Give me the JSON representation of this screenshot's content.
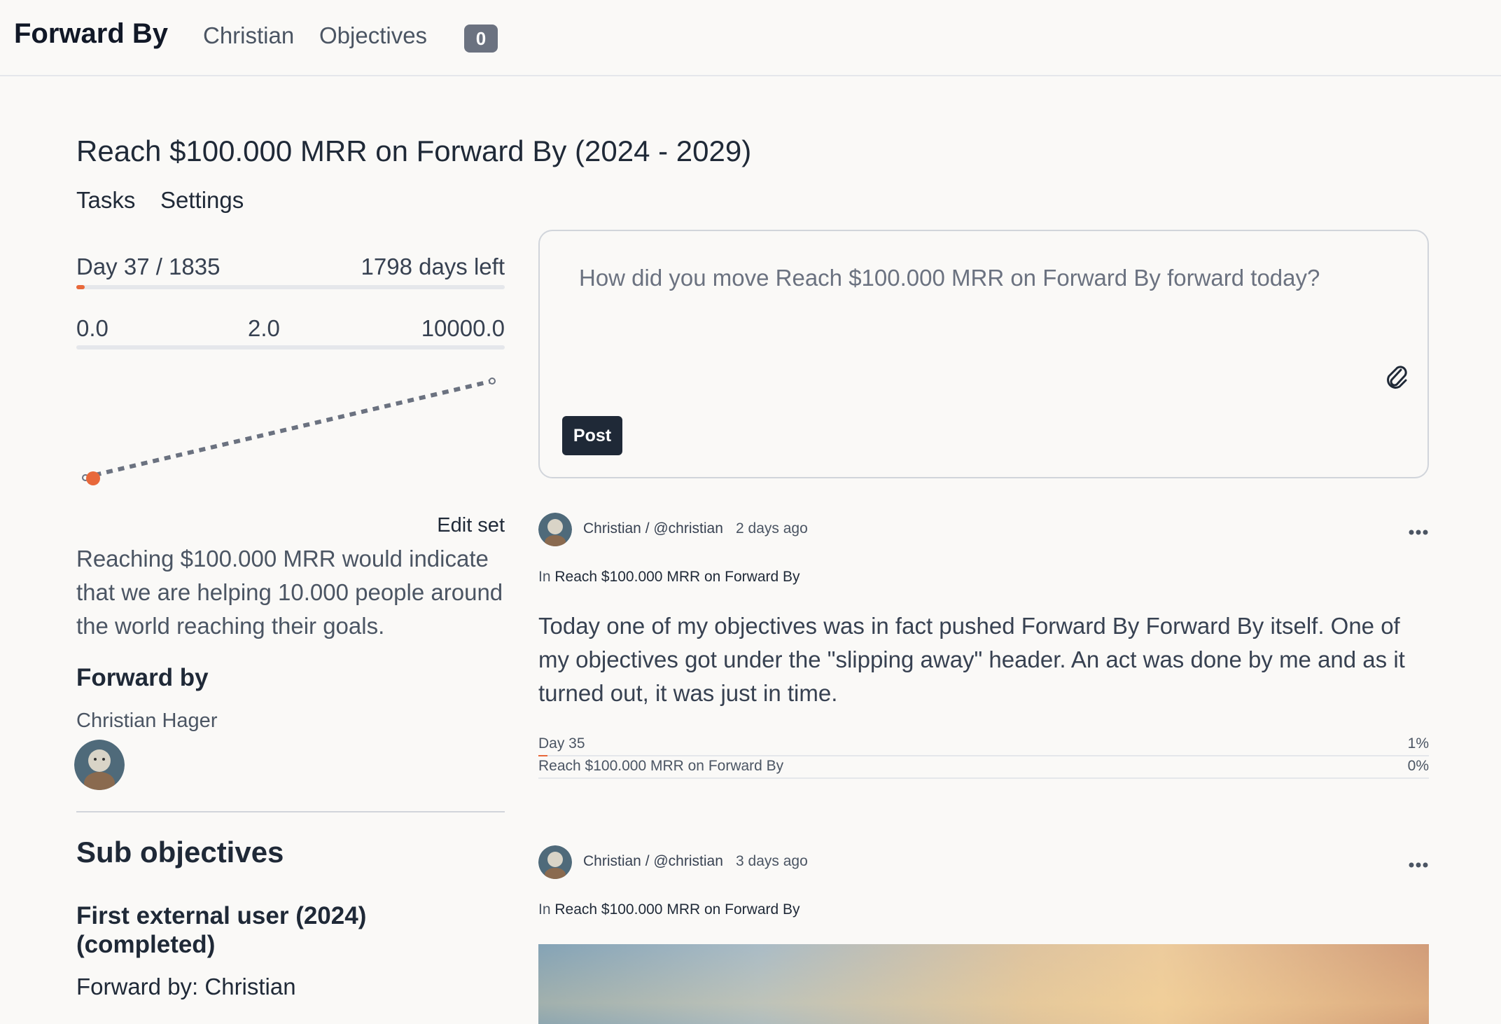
{
  "header": {
    "brand": "Forward By",
    "nav": {
      "user": "Christian",
      "objectives": "Objectives"
    },
    "badge_count": "0"
  },
  "objective": {
    "title": "Reach $100.000 MRR on Forward By (2024 - 2029)",
    "tabs": {
      "tasks": "Tasks",
      "settings": "Settings"
    },
    "days": {
      "label": "Day 37 / 1835",
      "left_label": "1798 days left",
      "progress_fraction": 0.02
    },
    "values": {
      "start": "0.0",
      "current": "2.0",
      "target": "10000.0",
      "progress_fraction": 0.0002
    },
    "edit_set_label": "Edit set",
    "description": "Reaching $100.000 MRR would indicate that we are helping 10.000 people around the world reaching their goals.",
    "forward_by_heading": "Forward by",
    "forward_by_name": "Christian Hager"
  },
  "sub_objectives": {
    "heading": "Sub objectives",
    "items": [
      {
        "title": "First external user (2024) (completed)",
        "forward_by": "Forward by: Christian"
      }
    ]
  },
  "composer": {
    "placeholder": "How did you move Reach $100.000 MRR on Forward By forward today?",
    "post_label": "Post",
    "attach_icon": "paperclip-icon"
  },
  "posts": [
    {
      "author": "Christian / @christian",
      "time": "2 days ago",
      "in_prefix": "In",
      "in_objective": "Reach $100.000 MRR on Forward By",
      "body": "Today one of my objectives was in fact pushed Forward By Forward By itself. One of my objectives got under the \"slipping away\" header. An act was done by me and as it turned out, it was just in time.",
      "day_label": "Day 35",
      "day_percent": "1%",
      "day_fraction": 0.01,
      "objective_label": "Reach $100.000 MRR on Forward By",
      "objective_percent": "0%",
      "objective_fraction": 0.0
    },
    {
      "author": "Christian / @christian",
      "time": "3 days ago",
      "in_prefix": "In",
      "in_objective": "Reach $100.000 MRR on Forward By"
    }
  ],
  "colors": {
    "accent": "#e8683a",
    "dark": "#1f2937",
    "badge": "#6b7280",
    "background": "#faf9f7"
  }
}
